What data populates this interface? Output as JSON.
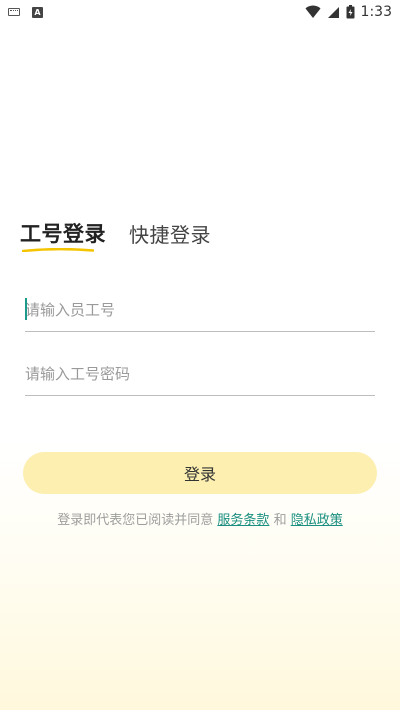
{
  "status_bar": {
    "time": "1:33"
  },
  "tabs": {
    "employee_login": "工号登录",
    "quick_login": "快捷登录"
  },
  "form": {
    "employee_id_placeholder": "请输入员工号",
    "password_placeholder": "请输入工号密码",
    "login_label": "登录"
  },
  "agreement": {
    "prefix": "登录即代表您已阅读并同意",
    "terms_link": "服务条款",
    "and": "和",
    "privacy_link": "隐私政策"
  },
  "colors": {
    "accent_yellow": "#f5c400",
    "button_bg": "#fcefb0",
    "link_teal": "#1a8f80"
  }
}
